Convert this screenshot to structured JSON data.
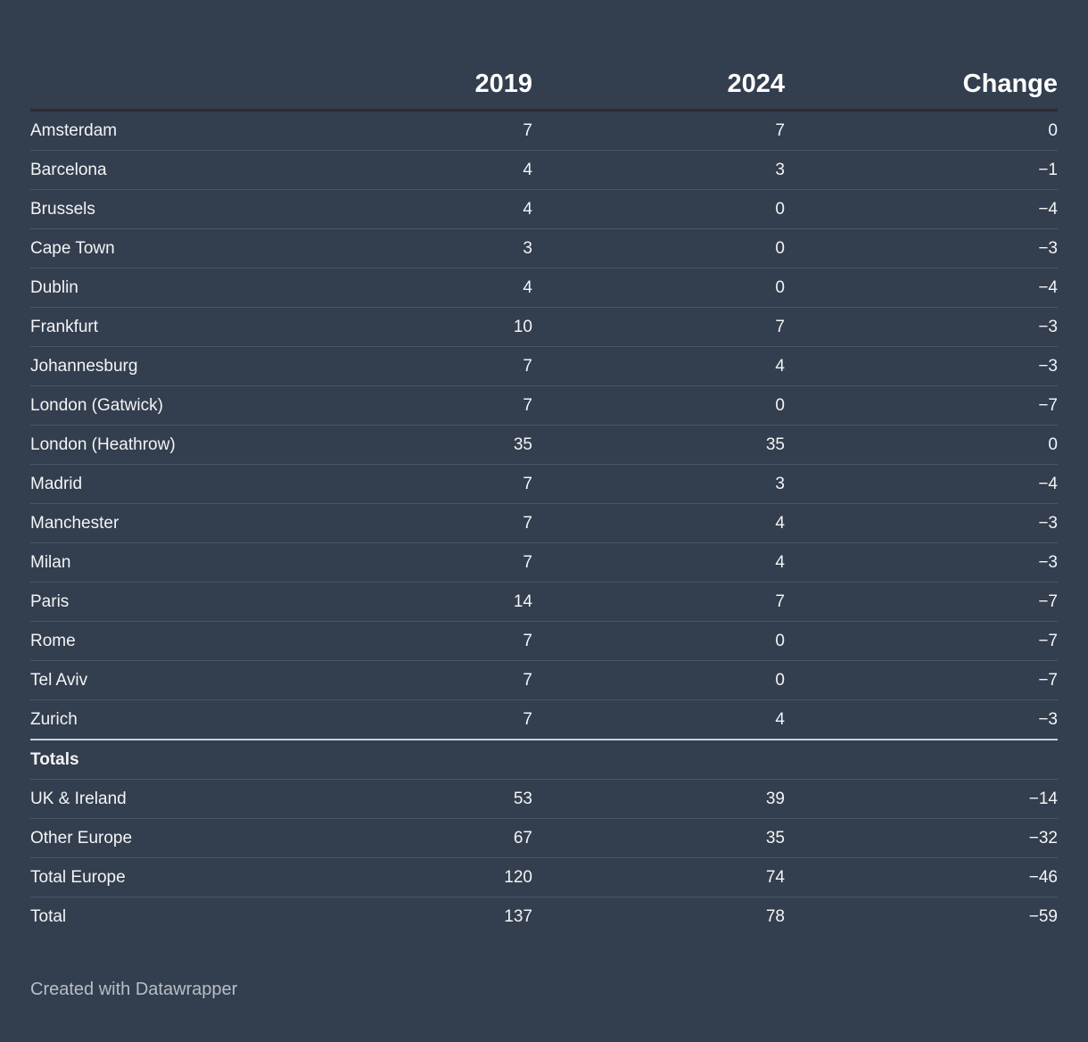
{
  "table": {
    "headers": [
      "",
      "2019",
      "2024",
      "Change"
    ],
    "rows": [
      [
        "Amsterdam",
        "7",
        "7",
        "0"
      ],
      [
        "Barcelona",
        "4",
        "3",
        "−1"
      ],
      [
        "Brussels",
        "4",
        "0",
        "−4"
      ],
      [
        "Cape Town",
        "3",
        "0",
        "−3"
      ],
      [
        "Dublin",
        "4",
        "0",
        "−4"
      ],
      [
        "Frankfurt",
        "10",
        "7",
        "−3"
      ],
      [
        "Johannesburg",
        "7",
        "4",
        "−3"
      ],
      [
        "London (Gatwick)",
        "7",
        "0",
        "−7"
      ],
      [
        "London (Heathrow)",
        "35",
        "35",
        "0"
      ],
      [
        "Madrid",
        "7",
        "3",
        "−4"
      ],
      [
        "Manchester",
        "7",
        "4",
        "−3"
      ],
      [
        "Milan",
        "7",
        "4",
        "−3"
      ],
      [
        "Paris",
        "14",
        "7",
        "−7"
      ],
      [
        "Rome",
        "7",
        "0",
        "−7"
      ],
      [
        "Tel Aviv",
        "7",
        "0",
        "−7"
      ],
      [
        "Zurich",
        "7",
        "4",
        "−3"
      ]
    ],
    "totals_label": "Totals",
    "totals": [
      [
        "UK & Ireland",
        "53",
        "39",
        "−14"
      ],
      [
        "Other Europe",
        "67",
        "35",
        "−32"
      ],
      [
        "Total Europe",
        "120",
        "74",
        "−46"
      ],
      [
        "Total",
        "137",
        "78",
        "−59"
      ]
    ]
  },
  "footer": {
    "credit": "Created with Datawrapper"
  },
  "colors": {
    "background": "#333e4e",
    "text": "#f3f4f6",
    "row_divider": "#4a5567",
    "section_divider": "#c9d1d4"
  }
}
